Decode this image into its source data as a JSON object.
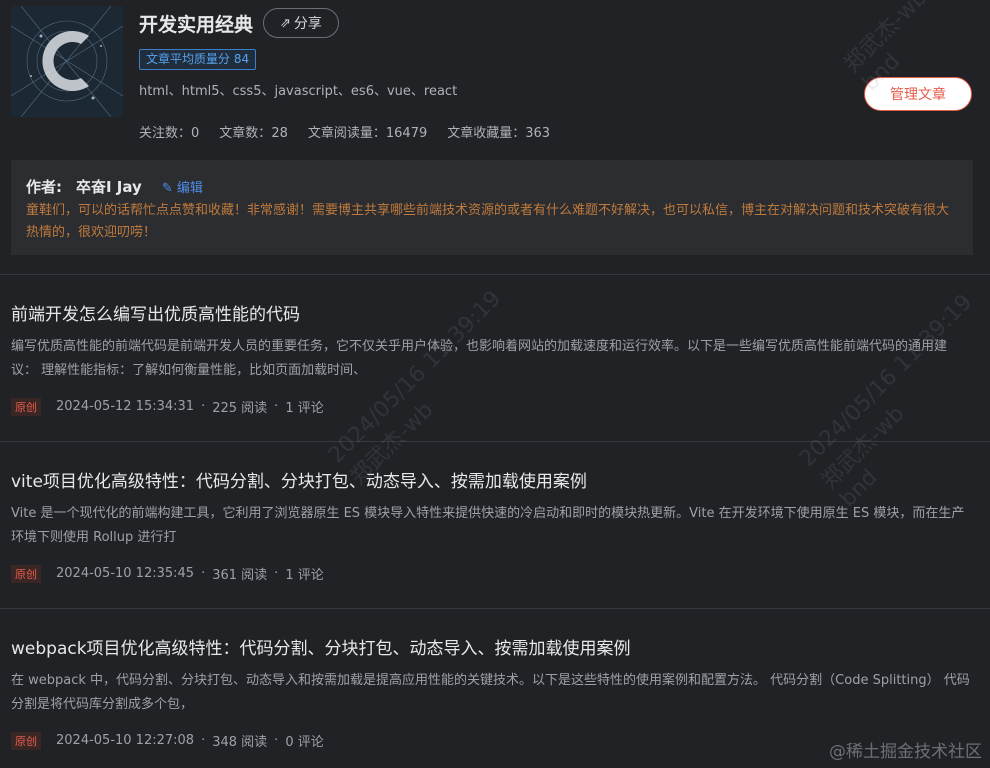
{
  "column": {
    "title": "开发实用经典",
    "share_label": "分享",
    "quality_label": "文章平均质量分 84",
    "tags": "html、html5、css5、javascript、es6、vue、react",
    "manage_label": "管理文章",
    "stats": [
      {
        "label": "关注数：",
        "value": "0"
      },
      {
        "label": "文章数：",
        "value": "28"
      },
      {
        "label": "文章阅读量：",
        "value": "16479"
      },
      {
        "label": "文章收藏量：",
        "value": "363"
      }
    ]
  },
  "author": {
    "label": "作者:",
    "name": "卒奋Ⅰ Jay",
    "edit_label": "编辑",
    "description": "童鞋们，可以的话帮忙点点赞和收藏！非常感谢！需要博主共享哪些前端技术资源的或者有什么难题不好解决，也可以私信，博主在对解决问题和技术突破有很大热情的，很欢迎叨唠！"
  },
  "posts": [
    {
      "title": "前端开发怎么编写出优质高性能的代码",
      "summary": "编写优质高性能的前端代码是前端开发人员的重要任务，它不仅关乎用户体验，也影响着网站的加载速度和运行效率。以下是一些编写优质高性能前端代码的通用建议： 理解性能指标：了解如何衡量性能，比如页面加载时间、",
      "badge": "原创",
      "date": "2024-05-12 15:34:31",
      "reads": "225 阅读",
      "comments": "1 评论"
    },
    {
      "title": "vite项目优化高级特性：代码分割、分块打包、动态导入、按需加载使用案例",
      "summary": "Vite 是一个现代化的前端构建工具，它利用了浏览器原生 ES 模块导入特性来提供快速的冷启动和即时的模块热更新。Vite 在开发环境下使用原生 ES 模块，而在生产环境下则使用 Rollup 进行打",
      "badge": "原创",
      "date": "2024-05-10 12:35:45",
      "reads": "361 阅读",
      "comments": "1 评论"
    },
    {
      "title": "webpack项目优化高级特性：代码分割、分块打包、动态导入、按需加载使用案例",
      "summary": "在 webpack 中，代码分割、分块打包、动态导入和按需加载是提高应用性能的关键技术。以下是这些特性的使用案例和配置方法。 代码分割（Code Splitting） 代码分割是将代码库分割成多个包，",
      "badge": "原创",
      "date": "2024-05-10 12:27:08",
      "reads": "348 阅读",
      "comments": "0 评论"
    }
  ],
  "watermark": {
    "line1": "2024/05/16 11:39:19",
    "line2": "郑武杰-wb",
    "line3": "bnd"
  },
  "site_mark": "@稀土掘金技术社区"
}
